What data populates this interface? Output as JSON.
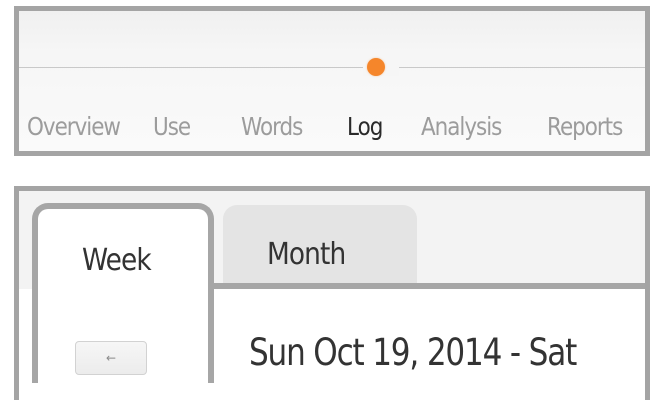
{
  "nav": {
    "tabs": [
      {
        "label": "Overview"
      },
      {
        "label": "Use"
      },
      {
        "label": "Words"
      },
      {
        "label": "Log"
      },
      {
        "label": "Analysis"
      },
      {
        "label": "Reports"
      }
    ],
    "active_tab": "Log",
    "accent_color": "#f5862b"
  },
  "calendar": {
    "tabs": {
      "week": "Week",
      "month": "Month"
    },
    "active_tab": "Week",
    "prev_button": "←",
    "date_range": "Sun Oct 19, 2014 - Sat"
  }
}
